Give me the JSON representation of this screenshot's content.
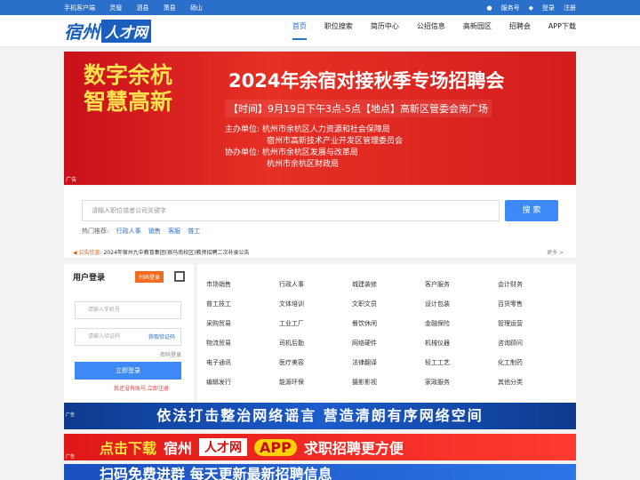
{
  "topbar": {
    "links": [
      "手机客户端",
      "灵璧",
      "泗县",
      "萧县",
      "砀山"
    ],
    "service": "服务号",
    "login": "登录",
    "register": "注册"
  },
  "logo": {
    "part1": "宿州",
    "part2": "人才网"
  },
  "nav": [
    "首页",
    "职位搜索",
    "简历中心",
    "公招信息",
    "高新园区",
    "招聘会",
    "APP下载"
  ],
  "banner": {
    "left_line1": "数字余杭",
    "left_line2": "智慧高新",
    "title": "2024年余宿对接秋季专场招聘会",
    "time": "【时间】9月19日下午3点-5点【地点】高新区管委会南广场",
    "host_label": "主办单位:",
    "host1": "杭州市余杭区人力资源和社会保障局",
    "host2": "宿州市高新技术产业开发区管理委员会",
    "co_label": "协办单位:",
    "co1": "杭州市余杭区发展与改革局",
    "co2": "杭州市余杭区财政局",
    "ad": "广告"
  },
  "search": {
    "placeholder": "请输入职位或者公司关键字",
    "button": "搜 索",
    "hot_label": "热门推荐:",
    "hot": [
      "行政人事",
      "销售",
      "客服",
      "普工"
    ]
  },
  "notice": {
    "label": "公告信息:",
    "text": "2024年宿州九中教育集团(宿马南校区)教师招聘二次补录公告",
    "more": "更多 >"
  },
  "login": {
    "title": "用户登录",
    "scan": "扫码登录",
    "phone_placeholder": "请输入手机号",
    "code_placeholder": "请输入验证码",
    "get_code": "获取验证码",
    "pwd_login": "密码登录",
    "button": "立即登录",
    "register": "我还没有账号,立即注册"
  },
  "categories": [
    "市场销售",
    "行政人事",
    "城建装修",
    "客户服务",
    "会计财务",
    "普工技工",
    "文体培训",
    "文职文员",
    "设计包装",
    "百货零售",
    "采购贸易",
    "工业工厂",
    "餐饮休闲",
    "金融保险",
    "管理运营",
    "物流贸易",
    "司机后勤",
    "网络硬件",
    "机械仪器",
    "咨询顾问",
    "电子通讯",
    "医疗美容",
    "法律翻译",
    "轻工工艺",
    "化工制药",
    "编辑发行",
    "能源环保",
    "摄影影视",
    "家政服务",
    "其他分类"
  ],
  "ads": {
    "s1": "依法打击整治网络谣言   营造清朗有序网络空间",
    "s2_dl": "点击下载",
    "s2_city": "宿州",
    "s2_brand": "人才网",
    "s2_app": "APP",
    "s2_tail": "求职招聘更方便",
    "s3": "扫码免费进群 每天更新最新招聘信息",
    "tag": "广告"
  },
  "colors": {
    "primary": "#2a6fc9",
    "button": "#3d8af7",
    "banner_red": "#d41d1d",
    "accent_orange": "#f46a1f"
  }
}
